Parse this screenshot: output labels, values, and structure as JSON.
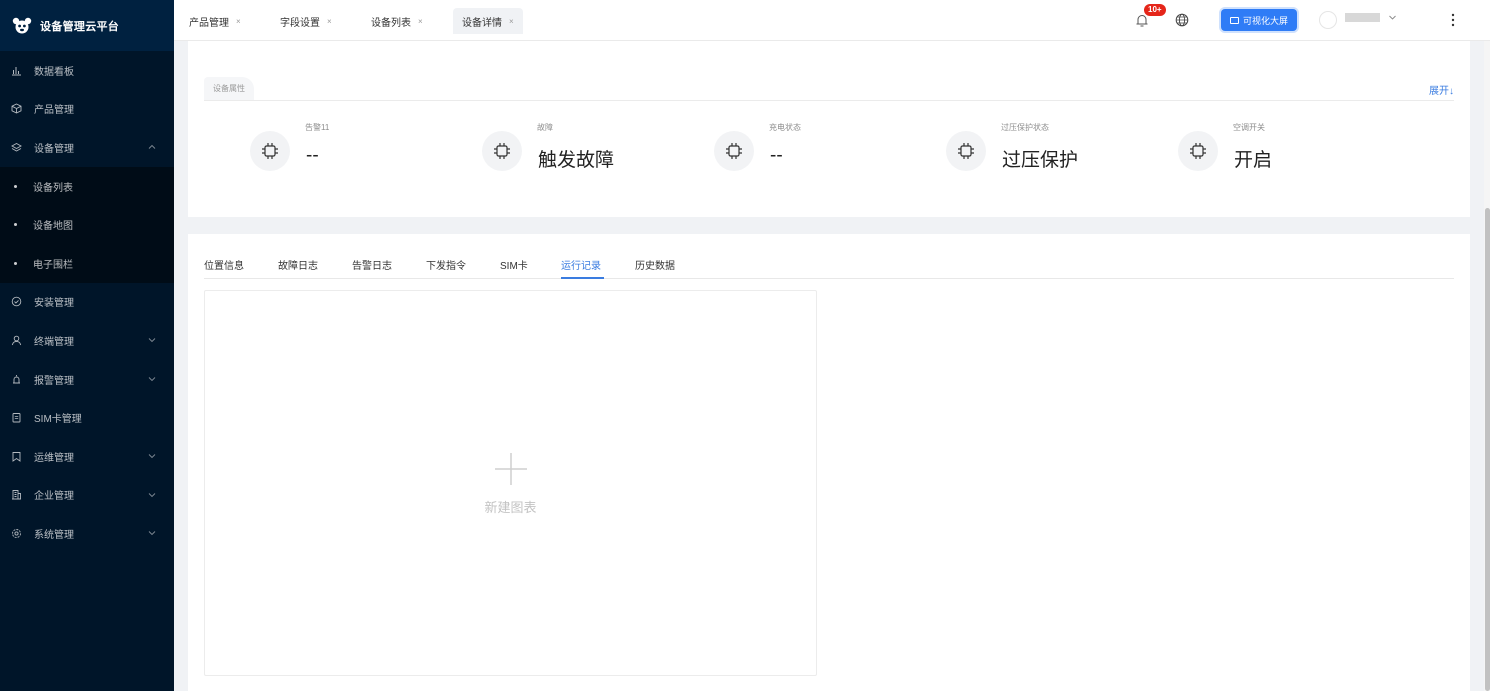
{
  "app": {
    "title": "设备管理云平台"
  },
  "sidebar": {
    "items": [
      {
        "label": "数据看板"
      },
      {
        "label": "产品管理"
      },
      {
        "label": "设备管理"
      },
      {
        "label": "安装管理"
      },
      {
        "label": "终端管理"
      },
      {
        "label": "报警管理"
      },
      {
        "label": "SIM卡管理"
      },
      {
        "label": "运维管理"
      },
      {
        "label": "企业管理"
      },
      {
        "label": "系统管理"
      }
    ],
    "device_submenu": [
      {
        "label": "设备列表"
      },
      {
        "label": "设备地图"
      },
      {
        "label": "电子围栏"
      }
    ]
  },
  "header": {
    "tabs": [
      {
        "label": "产品管理",
        "close": "×"
      },
      {
        "label": "字段设置",
        "close": "×"
      },
      {
        "label": "设备列表",
        "close": "×"
      },
      {
        "label": "设备详情",
        "close": "×"
      }
    ],
    "notification_badge": "10+",
    "bigscreen_label": "可视化大屏"
  },
  "attributes": {
    "tab_label": "设备属性",
    "expand_label": "展开↓",
    "items": [
      {
        "label": "告警11",
        "value": "--"
      },
      {
        "label": "故障",
        "value": "触发故障"
      },
      {
        "label": "充电状态",
        "value": "--"
      },
      {
        "label": "过压保护状态",
        "value": "过压保护"
      },
      {
        "label": "空调开关",
        "value": "开启"
      }
    ]
  },
  "records": {
    "tabs": [
      {
        "label": "位置信息"
      },
      {
        "label": "故障日志"
      },
      {
        "label": "告警日志"
      },
      {
        "label": "下发指令"
      },
      {
        "label": "SIM卡"
      },
      {
        "label": "运行记录"
      },
      {
        "label": "历史数据"
      }
    ],
    "active_tab": "运行记录",
    "new_chart_label": "新建图表"
  },
  "colors": {
    "sidebar_bg": "#001529",
    "accent": "#3a7ce0",
    "button": "#2f7cf6",
    "badge": "#e5261a"
  }
}
